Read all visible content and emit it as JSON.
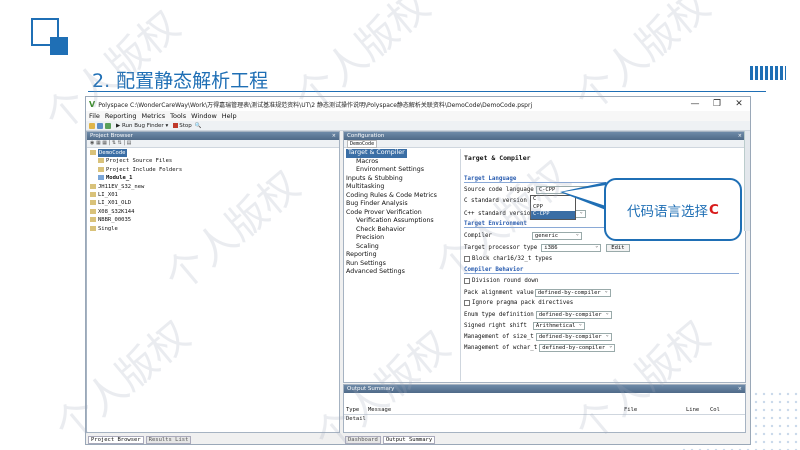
{
  "slide": {
    "title": "2. 配置静态解析工程",
    "callout_text": "代码语言选择",
    "callout_emphasis": "C",
    "watermark": "个人版权"
  },
  "window": {
    "title": "Polyspace C:\\WonderCareWay\\Work\\万得嘉瑞管理表\\测试基准规范资料\\UT\\2 静态测试操作说明\\Polyspace静态解析关联资料\\DemoCode\\DemoCode.psprj",
    "minimize": "—",
    "maximize": "❐",
    "close": "✕"
  },
  "menu": [
    "File",
    "Reporting",
    "Metrics",
    "Tools",
    "Window",
    "Help"
  ],
  "toolbar": {
    "run_label": "Run Bug Finder",
    "stop_label": "Stop"
  },
  "project_browser": {
    "title": "Project Browser",
    "items": [
      {
        "label": "DemoCode",
        "level": 0,
        "selected": true
      },
      {
        "label": "Project Source Files",
        "level": 1
      },
      {
        "label": "Project Include Folders",
        "level": 1
      },
      {
        "label": "Module_1",
        "level": 1,
        "bold": true
      },
      {
        "label": "JH11EV_S32_new",
        "level": 0
      },
      {
        "label": "LI_X01",
        "level": 0
      },
      {
        "label": "LI_X01_OLD",
        "level": 0
      },
      {
        "label": "X08_S32K144",
        "level": 0
      },
      {
        "label": "NBBR_00035",
        "level": 0
      },
      {
        "label": "Single",
        "level": 0
      }
    ]
  },
  "configuration": {
    "title": "Configuration",
    "tab": "DemoCode",
    "tree": [
      {
        "label": "Target & Compiler",
        "level": 1,
        "selected": true
      },
      {
        "label": "Macros",
        "level": 2
      },
      {
        "label": "Environment Settings",
        "level": 2
      },
      {
        "label": "Inputs & Stubbing",
        "level": 1
      },
      {
        "label": "Multitasking",
        "level": 1
      },
      {
        "label": "Coding Rules & Code Metrics",
        "level": 1
      },
      {
        "label": "Bug Finder Analysis",
        "level": 1
      },
      {
        "label": "Code Prover Verification",
        "level": 1
      },
      {
        "label": "Verification Assumptions",
        "level": 2
      },
      {
        "label": "Check Behavior",
        "level": 2
      },
      {
        "label": "Precision",
        "level": 2
      },
      {
        "label": "Scaling",
        "level": 2
      },
      {
        "label": "Reporting",
        "level": 1
      },
      {
        "label": "Run Settings",
        "level": 1
      },
      {
        "label": "Advanced Settings",
        "level": 1
      }
    ],
    "form": {
      "heading": "Target & Compiler",
      "sec_language": "Target Language",
      "source_code_language_label": "Source code language",
      "source_code_language_value": "C-CPP",
      "language_options": [
        "C",
        "CPP",
        "C-CPP"
      ],
      "c_standard_label": "C standard version",
      "cpp_standard_label": "C++ standard version",
      "cpp_standard_value": "ler",
      "sec_environment": "Target Environment",
      "compiler_label": "Compiler",
      "compiler_value": "generic",
      "target_processor_label": "Target processor type",
      "target_processor_value": "i386",
      "edit_button": "Edit",
      "block_char_label": "Block char16/32_t types",
      "sec_behavior": "Compiler Behavior",
      "division_label": "Division round down",
      "pack_label": "Pack alignment value",
      "pack_value": "defined-by-compiler",
      "ignore_pragma_label": "Ignore pragma pack directives",
      "enum_label": "Enum type definition",
      "enum_value": "defined-by-compiler",
      "signed_shift_label": "Signed right shift",
      "signed_shift_value": "Arithmetical",
      "size_t_label": "Management of size_t",
      "size_t_value": "defined-by-compiler",
      "wchar_label": "Management of wchar_t",
      "wchar_value": "defined-by-compiler"
    }
  },
  "output_summary": {
    "title": "Output Summary",
    "columns": [
      "Type",
      "Message",
      "File",
      "Line",
      "Col"
    ],
    "row_type": "Detail"
  },
  "bottom_tabs_left": [
    "Project Browser",
    "Results List"
  ],
  "bottom_tabs_right": [
    "Dashboard",
    "Output Summary"
  ]
}
